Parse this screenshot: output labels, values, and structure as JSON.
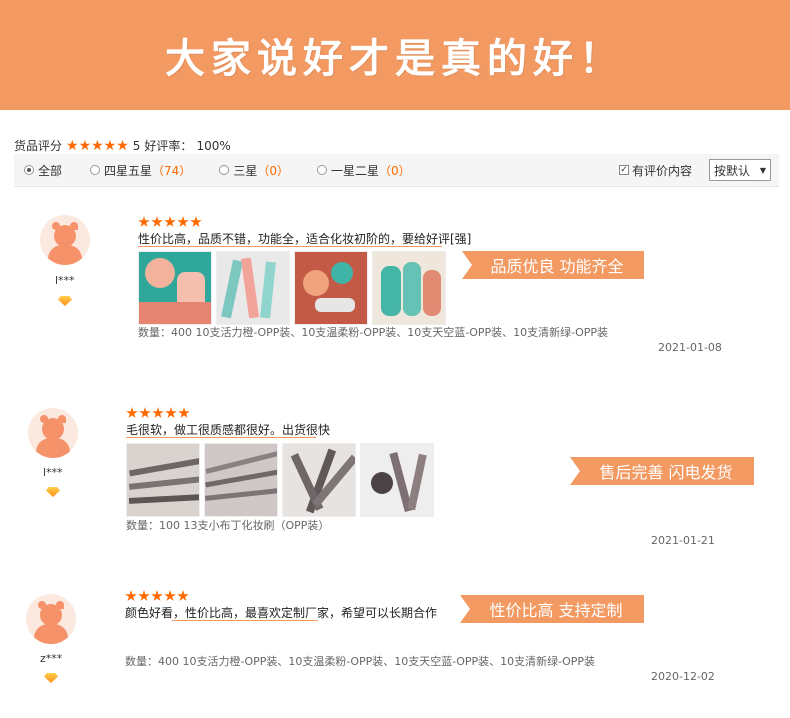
{
  "banner": {
    "title": "大家说好才是真的好！"
  },
  "summary": {
    "label": "货品评分",
    "score": "5",
    "good_rate_label": "好评率：",
    "good_rate": "100%"
  },
  "filters": {
    "all": "全部",
    "four_five": "四星五星",
    "four_five_count": "（74）",
    "three": "三星",
    "three_count": "（0）",
    "one_two": "一星二星",
    "one_two_count": "（0）",
    "has_content": "有评价内容",
    "sort": "按默认"
  },
  "reviews": [
    {
      "username": "l***",
      "comment": "性价比高，品质不错，功能全，适合化妆初阶的，要给好评[强]",
      "meta": "数量：400   10支活力橙-OPP装、10支温柔粉-OPP装、10支天空蓝-OPP装、10支清新绿-OPP装",
      "date": "2021-01-08",
      "tag": "品质优良 功能齐全"
    },
    {
      "username": "l***",
      "comment": "毛很软，做工很质感都很好。出货很快",
      "meta": "数量：100   13支小布丁化妆刷（OPP装）",
      "date": "2021-01-21",
      "tag": "售后完善 闪电发货"
    },
    {
      "username": "z***",
      "comment": "颜色好看，性价比高，最喜欢定制厂家，希望可以长期合作",
      "meta": "数量：400   10支活力橙-OPP装、10支温柔粉-OPP装、10支天空蓝-OPP装、10支清新绿-OPP装",
      "date": "2020-12-02",
      "tag": "性价比高 支持定制"
    }
  ],
  "colors": {
    "accent": "#f39a63",
    "star": "#ff6a00"
  },
  "icons": [
    "star-icon",
    "vip-diamond-icon",
    "avatar-icon",
    "dropdown-arrow-icon"
  ]
}
